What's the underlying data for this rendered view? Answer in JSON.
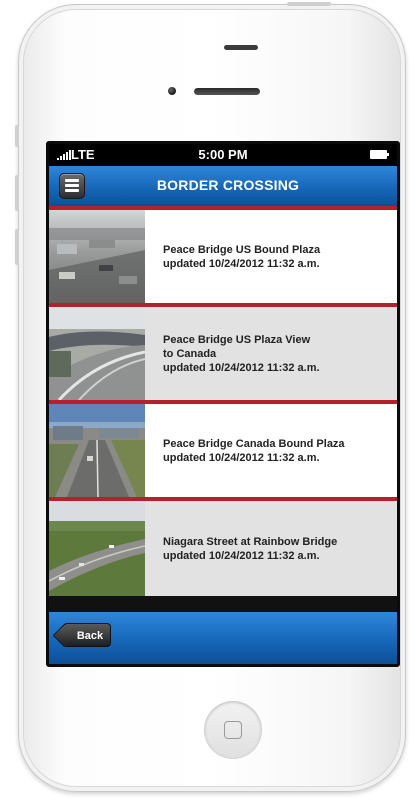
{
  "status_bar": {
    "carrier": "LTE",
    "time": "5:00 PM"
  },
  "nav": {
    "title": "BORDER CROSSING",
    "menu_icon": "hamburger-menu-icon"
  },
  "cameras": [
    {
      "title": "Peace Bridge US Bound Plaza",
      "updated": "updated 10/24/2012 11:32 a.m."
    },
    {
      "title": "Peace Bridge US Plaza View",
      "title_line2": "to Canada",
      "updated": "updated 10/24/2012 11:32 a.m."
    },
    {
      "title": "Peace Bridge Canada Bound Plaza",
      "updated": "updated 10/24/2012 11:32 a.m."
    },
    {
      "title": "Niagara Street at Rainbow Bridge",
      "updated": "updated 10/24/2012 11:32 a.m."
    }
  ],
  "toolbar": {
    "back_label": "Back"
  },
  "colors": {
    "nav_blue": "#1667b9",
    "divider_red": "#b1222c",
    "row_alt": "#e2e2e2"
  }
}
